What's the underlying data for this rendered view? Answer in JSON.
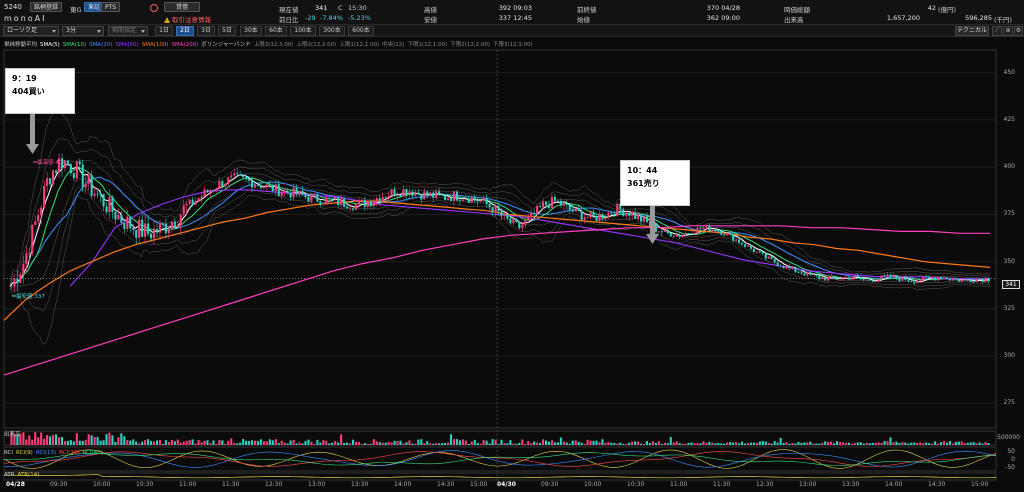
{
  "header": {
    "code": "5240",
    "name": "monoAI",
    "watch_button": "銘柄登録",
    "market": "東G",
    "exchange_tabs": [
      "東証",
      "PTS"
    ],
    "lending_badge": "貸借",
    "regulation_notice": "取引注意情報",
    "stats": {
      "current_label": "現在値",
      "current_value": "341",
      "current_flag": "C",
      "current_time": "15:30",
      "change_label": "前日比",
      "change_value": "-29",
      "change_pct": "-7.84%",
      "change_pct2": "-5.23%",
      "high_label": "高値",
      "high_value": "392 09:03",
      "low_label": "安値",
      "low_value": "337 12:45",
      "prev_close_label": "前終値",
      "prev_close_value": "370 04/28",
      "open_label": "始値",
      "open_value": "362 09:00",
      "market_cap_label": "時価総額",
      "market_cap_value": "42",
      "market_cap_unit": "(億円)",
      "volume_label": "出来高",
      "volume_value": "1,657,200",
      "turnover_value": "596,285",
      "turnover_unit": "(千円)"
    }
  },
  "toolbar": {
    "chart_type": "ローソク足",
    "interval": "3分",
    "period_select": "期間指定",
    "periods": [
      "1日",
      "2日",
      "3日",
      "5日",
      "30本",
      "60本",
      "100本",
      "300本",
      "600本"
    ],
    "active_period": "2日",
    "technical_button": "テクニカル"
  },
  "legend": {
    "items": [
      {
        "label": "単純移動平均",
        "color": "#cccccc"
      },
      {
        "label": "SMA(5)",
        "color": "#ffffff"
      },
      {
        "label": "SMA(10)",
        "color": "#35e07a"
      },
      {
        "label": "SMA(20)",
        "color": "#3b8fff"
      },
      {
        "label": "SMA(50)",
        "color": "#9a35ff"
      },
      {
        "label": "SMA(100)",
        "color": "#ff7a1a"
      },
      {
        "label": "SMA(200)",
        "color": "#ff3fc0"
      },
      {
        "label": "ボリンジャーバンド",
        "color": "#cccccc"
      },
      {
        "label": "上限3(12,3.00)",
        "color": "#888888"
      },
      {
        "label": "上限2(12,2.00)",
        "color": "#888888"
      },
      {
        "label": "上限1(12,1.00)",
        "color": "#888888"
      },
      {
        "label": "中央(12)",
        "color": "#888888"
      },
      {
        "label": "下限1(12,1.00)",
        "color": "#888888"
      },
      {
        "label": "下限2(12,2.00)",
        "color": "#888888"
      },
      {
        "label": "下限3(12,3.00)",
        "color": "#888888"
      }
    ]
  },
  "annotations": {
    "buy": {
      "time": "9：19",
      "text": "404買い"
    },
    "sell": {
      "time": "10：44",
      "text": "361売り"
    },
    "high_marker": "最高値:406",
    "low_marker": "最安値:337",
    "last_price": "341"
  },
  "panels": {
    "volume_label": "出来高",
    "volume_scale": "500000",
    "rci_items": [
      {
        "label": "RCI",
        "color": "#cccccc"
      },
      {
        "label": "RCI(9)",
        "color": "#e6d34a"
      },
      {
        "label": "RCI(13)",
        "color": "#3b8fff"
      },
      {
        "label": "RCI(26)",
        "color": "#ff4a4a"
      },
      {
        "label": "RCI(40)",
        "color": "#35e07a"
      }
    ],
    "rci_scale": [
      "50",
      "0",
      "-50"
    ],
    "atr_items": [
      {
        "label": "ATR",
        "color": "#cccccc"
      },
      {
        "label": "ATR(14)",
        "color": "#e6d34a"
      }
    ]
  },
  "chart_data": {
    "type": "candlestick",
    "ylim": [
      262,
      462
    ],
    "y_ticks": [
      450,
      425,
      400,
      375,
      350,
      325,
      300,
      275
    ],
    "x_labels": [
      "04/28",
      "09:30",
      "10:00",
      "10:30",
      "11:00",
      "11:30",
      "12:30",
      "13:00",
      "13:30",
      "14:00",
      "14:30",
      "15:00",
      "04/30",
      "09:30",
      "10:00",
      "10:30",
      "11:00",
      "11:30",
      "12:30",
      "13:00",
      "13:30",
      "14:00",
      "14:30",
      "15:00"
    ],
    "close_path": [
      337,
      350,
      372,
      395,
      404,
      400,
      392,
      385,
      378,
      372,
      368,
      365,
      367,
      372,
      378,
      383,
      388,
      392,
      394,
      393,
      391,
      389,
      387,
      386,
      384,
      383,
      382,
      381,
      380,
      382,
      385,
      387,
      388,
      386,
      385,
      384,
      385,
      384,
      382,
      378,
      372,
      368,
      373,
      380,
      382,
      378,
      375,
      373,
      375,
      378,
      376,
      372,
      368,
      365,
      364,
      366,
      368,
      367,
      364,
      360,
      356,
      352,
      349,
      346,
      344,
      342,
      341,
      341,
      342,
      340,
      341,
      342,
      341,
      340,
      341,
      342,
      341,
      340,
      341,
      341
    ],
    "series": [
      {
        "name": "SMA(5)",
        "color": "#ffffff"
      },
      {
        "name": "SMA(10)",
        "color": "#35e07a"
      },
      {
        "name": "SMA(20)",
        "color": "#3b8fff"
      },
      {
        "name": "SMA(50)",
        "color": "#9a35ff",
        "values": [
          337,
          350,
          368,
          375,
          380,
          384,
          387,
          388,
          388,
          387,
          386,
          385,
          384,
          382,
          380,
          379,
          378,
          377,
          376,
          375,
          374,
          372,
          370,
          368,
          366,
          364,
          362,
          360,
          357,
          354,
          351,
          349,
          347,
          345,
          344,
          343,
          342,
          342,
          342,
          341,
          341,
          341
        ]
      },
      {
        "name": "SMA(100)",
        "color": "#ff7a1a",
        "values": [
          319,
          330,
          338,
          345,
          350,
          355,
          359,
          362,
          365,
          368,
          371,
          373,
          376,
          378,
          380,
          381,
          382,
          382,
          381,
          380,
          379,
          378,
          377,
          375,
          374,
          373,
          372,
          371,
          370,
          369,
          368,
          367,
          366,
          365,
          363,
          362,
          360,
          359,
          357,
          356,
          354,
          352,
          350,
          349,
          348,
          347
        ]
      },
      {
        "name": "SMA(200)",
        "color": "#ff3fc0",
        "values": [
          290,
          295,
          300,
          305,
          310,
          315,
          320,
          325,
          330,
          335,
          340,
          345,
          349,
          352,
          356,
          359,
          362,
          364,
          365,
          366,
          367,
          368,
          368,
          369,
          369,
          369,
          369,
          368,
          368,
          367,
          366,
          366,
          365,
          365
        ]
      }
    ]
  }
}
